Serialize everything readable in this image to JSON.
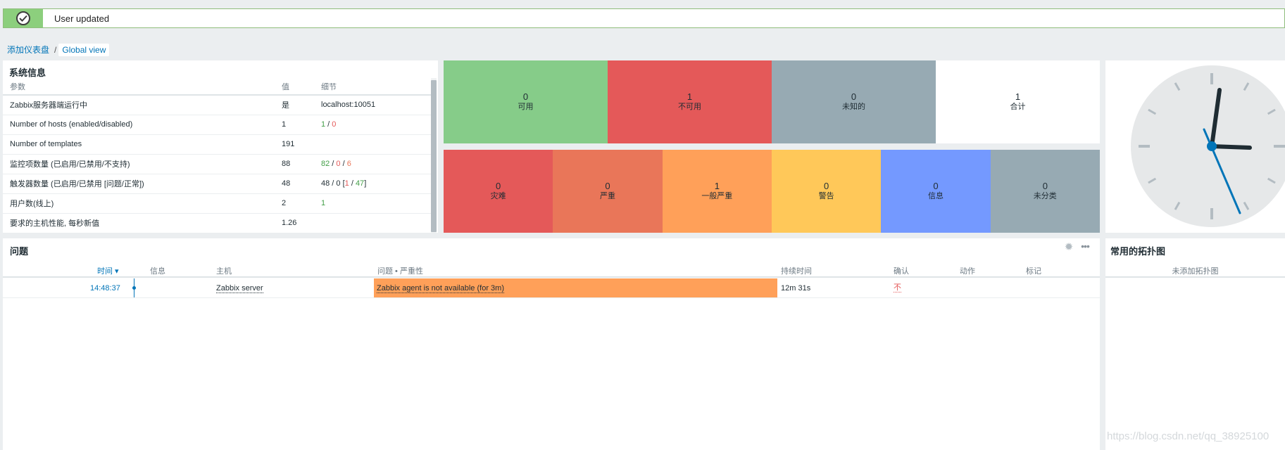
{
  "message": {
    "text": "User updated",
    "icon": "check-circle-icon"
  },
  "breadcrumb": {
    "add_label": "添加仪表盘",
    "separator": "/",
    "current": "Global view"
  },
  "system_info": {
    "title": "系统信息",
    "headers": {
      "param": "参数",
      "value": "值",
      "details": "细节"
    },
    "rows": [
      {
        "param": "Zabbix服务器端运行中",
        "value": "是",
        "details": "localhost:10051"
      },
      {
        "param": "Number of hosts (enabled/disabled)",
        "value": "1",
        "d1": "1",
        "sep1": " / ",
        "d2": "0"
      },
      {
        "param": "Number of templates",
        "value": "191",
        "details": ""
      },
      {
        "param": "监控项数量 (已启用/已禁用/不支持)",
        "value": "88",
        "d1": "82",
        "sep1": " / ",
        "d2": "0",
        "sep2": " / ",
        "d3": "6"
      },
      {
        "param": "触发器数量 (已启用/已禁用 [问题/正常])",
        "value": "48",
        "pre": "48 / 0 [",
        "d1": "1",
        "sep1": " / ",
        "d2": "47",
        "post": "]"
      },
      {
        "param": "用户数(线上)",
        "value": "2",
        "d1": "1"
      },
      {
        "param": "要求的主机性能, 每秒新值",
        "value": "1.26",
        "details": ""
      }
    ]
  },
  "host_availability": [
    {
      "count": "0",
      "label": "可用",
      "color": "#86cc89"
    },
    {
      "count": "1",
      "label": "不可用",
      "color": "#e45959"
    },
    {
      "count": "0",
      "label": "未知的",
      "color": "#97aab3"
    },
    {
      "count": "1",
      "label": "合计",
      "color": "#ffffff"
    }
  ],
  "severities": [
    {
      "count": "0",
      "label": "灾难",
      "color": "#e45959"
    },
    {
      "count": "0",
      "label": "严重",
      "color": "#e97659"
    },
    {
      "count": "1",
      "label": "一般严重",
      "color": "#ffa059"
    },
    {
      "count": "0",
      "label": "警告",
      "color": "#ffc859"
    },
    {
      "count": "0",
      "label": "信息",
      "color": "#7499ff"
    },
    {
      "count": "0",
      "label": "未分类",
      "color": "#97aab3"
    }
  ],
  "problems": {
    "title": "问题",
    "headers": {
      "time": "时间 ▾",
      "info": "信息",
      "host": "主机",
      "problem": "问题 • 严重性",
      "duration": "持续时间",
      "ack": "确认",
      "actions": "动作",
      "tags": "标记"
    },
    "rows": [
      {
        "time": "14:48:37",
        "host": "Zabbix server",
        "problem": "Zabbix agent is not available (for 3m)",
        "duration": "12m 31s",
        "ack": "不",
        "severity_color": "#ffa059"
      }
    ]
  },
  "maps": {
    "title": "常用的拓扑图",
    "empty": "未添加拓扑图"
  },
  "watermark": "https://blog.csdn.net/qq_38925100"
}
